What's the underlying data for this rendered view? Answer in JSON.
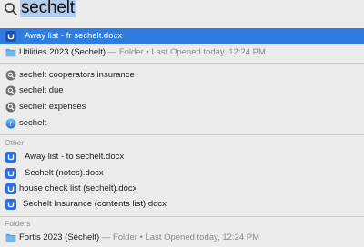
{
  "search": {
    "query": "sechelt"
  },
  "top_hit": {
    "label": "Away list - fr sechelt.docx"
  },
  "top_results": [
    {
      "label": "Utilities 2023 (Sechelt)",
      "meta": " — Folder • Last Opened today, 12:24 PM",
      "icon": "folder-icon"
    }
  ],
  "suggestions": [
    {
      "label": "sechelt cooperators insurance",
      "icon": "search-suggestion-icon"
    },
    {
      "label": "sechelt due",
      "icon": "search-suggestion-icon"
    },
    {
      "label": "sechelt expenses",
      "icon": "search-suggestion-icon"
    },
    {
      "label": "sechelt",
      "icon": "web-search-icon"
    }
  ],
  "sections": {
    "other": "Other",
    "folders": "Folders"
  },
  "other_results": [
    {
      "label": "Away list - to sechelt.docx",
      "icon": "word-document-icon"
    },
    {
      "label": "Sechelt (notes).docx",
      "icon": "word-document-icon"
    },
    {
      "label": "house check list (sechelt).docx",
      "icon": "word-document-icon"
    },
    {
      "label": "Sechelt Insurance (contents list).docx",
      "icon": "word-document-icon"
    }
  ],
  "folder_results": [
    {
      "label": "Fortis 2023 (Sechelt)",
      "meta": " — Folder • Last Opened today, 12:24 PM",
      "icon": "folder-icon"
    }
  ],
  "colors": {
    "selection": "#2f7de0",
    "word_blue": "#2b6ee0",
    "folder_blue": "#5aa7e8",
    "meta_gray": "#8a8a8e",
    "query_highlight": "#b4cdee"
  }
}
